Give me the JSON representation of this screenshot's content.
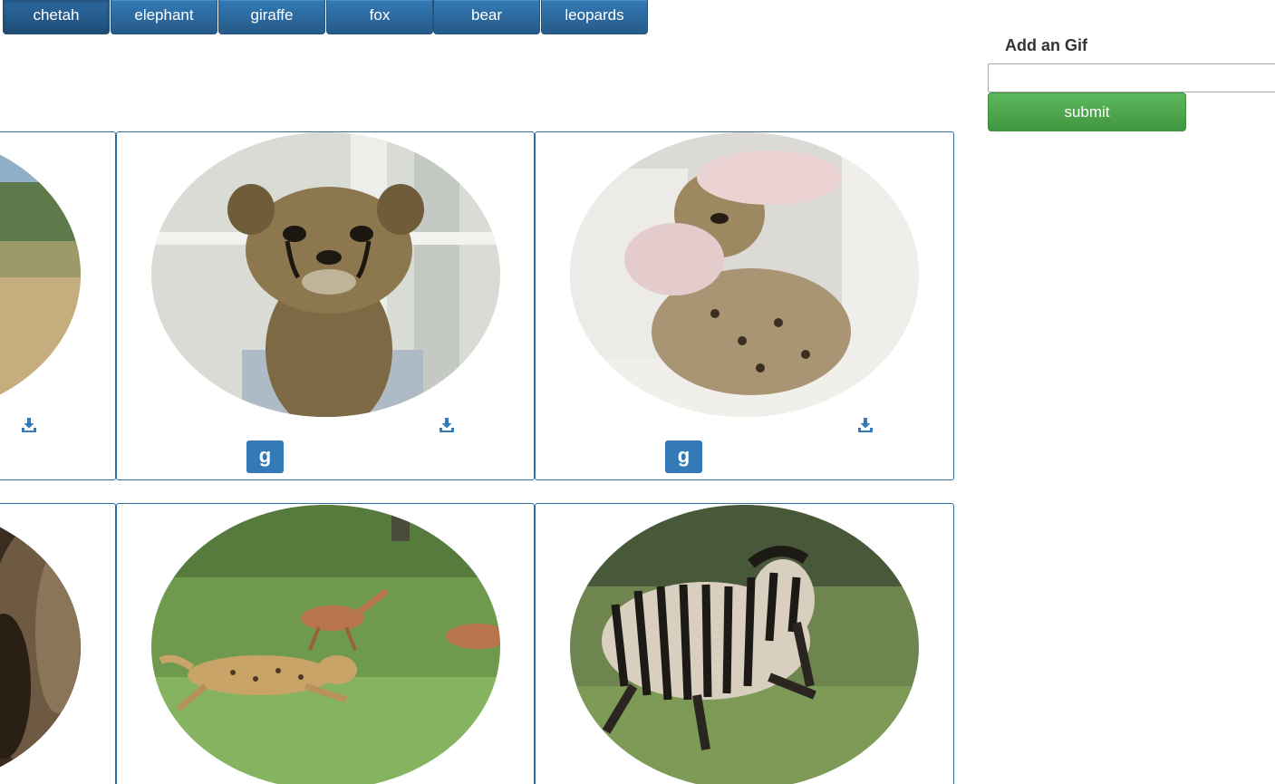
{
  "categories": {
    "items": [
      "chetah",
      "elephant",
      "giraffe",
      "fox",
      "bear",
      "leopards"
    ],
    "active": "chetah"
  },
  "add_form": {
    "label": "Add an Gif",
    "input_value": "",
    "submit_label": "submit"
  },
  "cards": [
    {
      "badge": "",
      "image": "cheetah-savanna"
    },
    {
      "badge": "g",
      "image": "cheetah-cub-portrait"
    },
    {
      "badge": "g",
      "image": "cheetah-cub-petted"
    },
    {
      "badge": "",
      "image": "cheetah-closeup"
    },
    {
      "badge": "",
      "image": "cheetah-chasing-gazelles"
    },
    {
      "badge": "",
      "image": "zebra-running"
    }
  ],
  "icons": {
    "download": "download-icon"
  },
  "colors": {
    "primary": "#337ab7",
    "success": "#5cb85c",
    "card_border": "#2e6da4"
  }
}
